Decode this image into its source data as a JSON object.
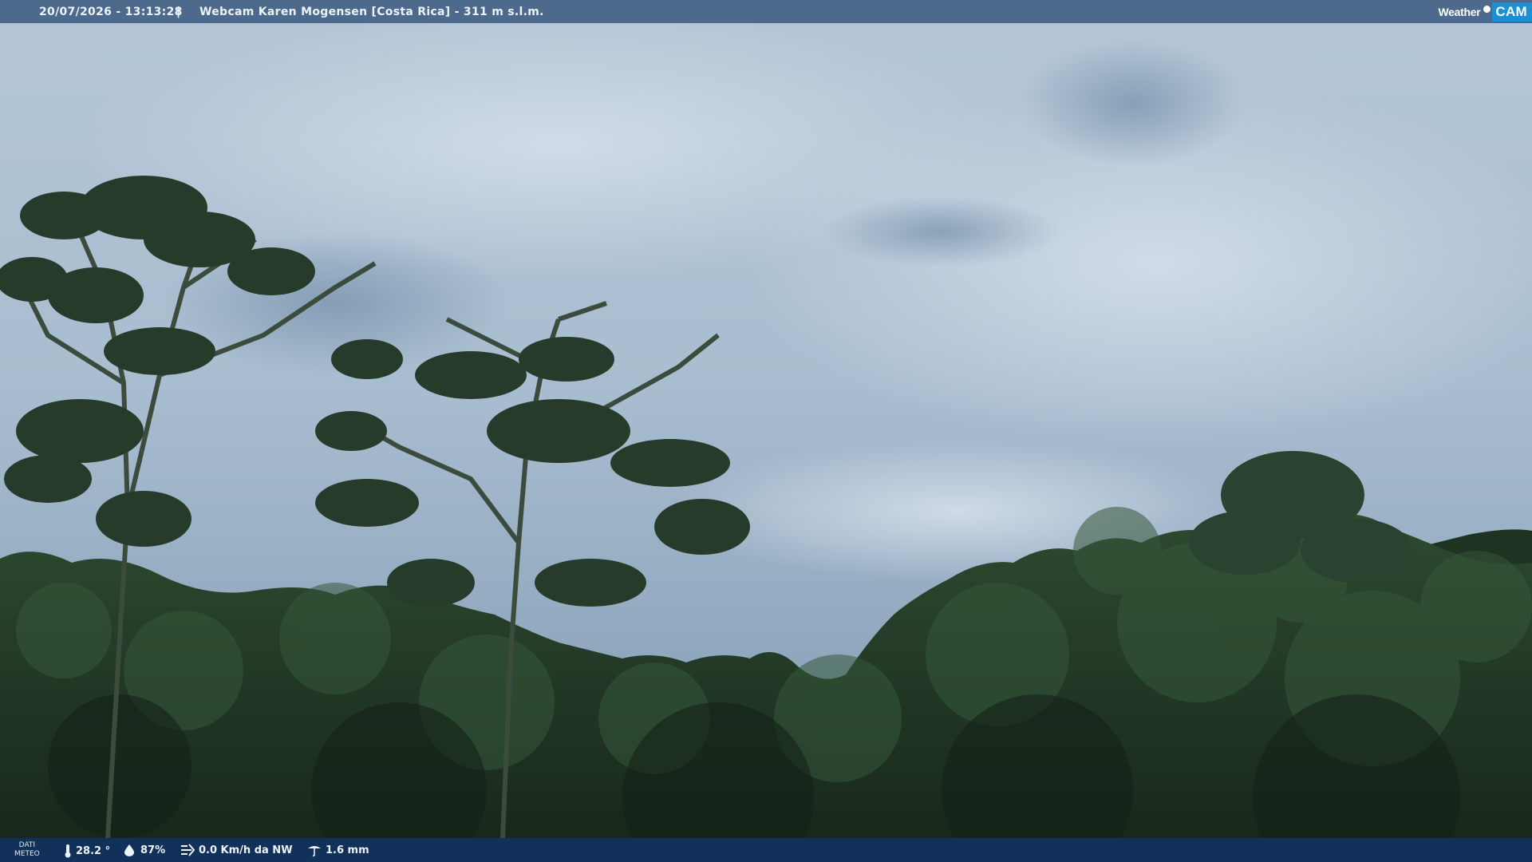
{
  "header": {
    "datetime": "20/07/2026 - 13:13:28",
    "separator": "|",
    "title": "Webcam Karen Mogensen [Costa Rica] - 311 m s.l.m."
  },
  "logo": {
    "weather": "Weather",
    "cam": "CAM"
  },
  "weather_bar": {
    "label_line1": "DATI",
    "label_line2": "METEO",
    "temperature": "28.2 °",
    "humidity": "87%",
    "wind": "0.0 Km/h da NW",
    "rain": "1.6 mm"
  },
  "colors": {
    "sky_top": "#b9cad9",
    "sky_bottom": "#7f98b2",
    "forest_dark": "#1a2a1c",
    "forest_mid": "#2c4a2e",
    "bar_top": "#305078",
    "bar_bottom": "#123260",
    "logo_accent": "#1c8fd6"
  },
  "icons": [
    "thermometer-icon",
    "humidity-icon",
    "wind-icon",
    "rain-icon"
  ]
}
